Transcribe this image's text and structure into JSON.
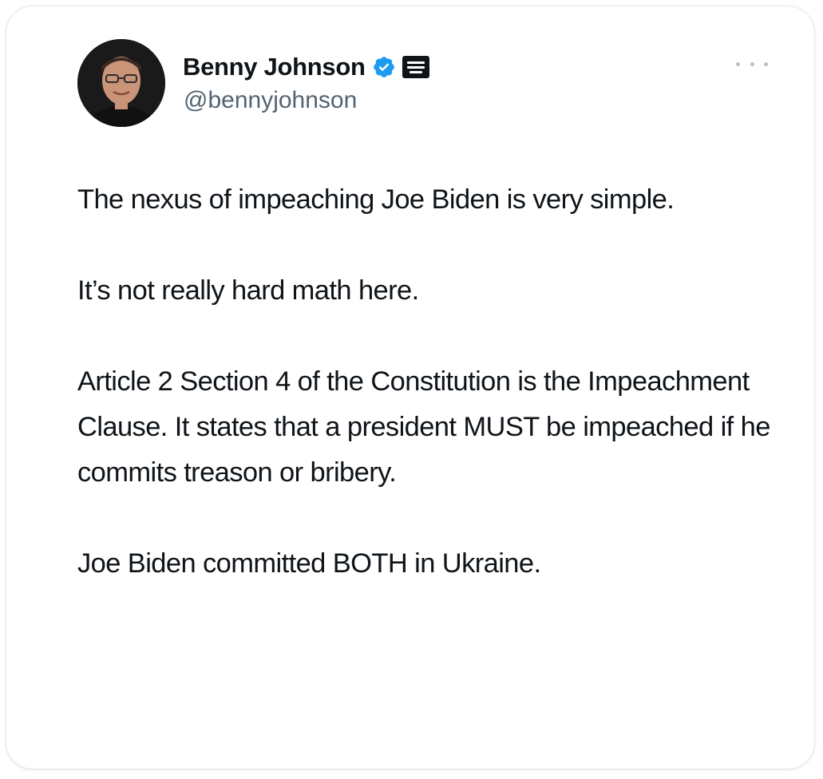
{
  "author": {
    "display_name": "Benny Johnson",
    "handle": "@bennyjohnson",
    "verified_icon": "verified-badge-icon",
    "affiliate_icon": "affiliate-badge-icon",
    "avatar_icon": "profile-avatar"
  },
  "post": {
    "paragraphs": [
      "The nexus of impeaching Joe Biden is very simple.",
      "It’s not really hard math here.",
      "Article 2 Section 4 of the Constitution is the Impeachment Clause. It states that a president MUST be impeached if he commits treason or bribery.",
      "Joe Biden committed BOTH in Ukraine."
    ]
  },
  "actions": {
    "more_icon": "more-options-icon"
  },
  "colors": {
    "text": "#0f1419",
    "secondary": "#536471",
    "verified": "#1d9bf0",
    "border": "#e6e6e6"
  }
}
